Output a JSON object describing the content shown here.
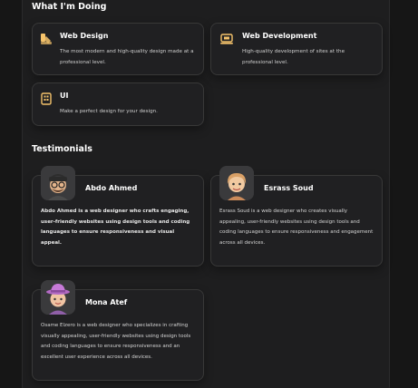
{
  "doing": {
    "title": "What I'm Doing",
    "services": [
      {
        "icon": "design-icon",
        "title": "Web Design",
        "text": "The most modern and high-quality design made at a professional level."
      },
      {
        "icon": "code-icon",
        "title": "Web Development",
        "text": "High-quality development of sites at the professional level."
      },
      {
        "icon": "ui-icon",
        "title": "UI",
        "text": "Make a perfect design for your design."
      }
    ]
  },
  "testimonials": {
    "title": "Testimonials",
    "items": [
      {
        "name": "Abdo Ahmed",
        "text": "Abdo Ahmed is a web designer who crafts engaging, user-friendly websites using design tools and coding languages to ensure responsiveness and visual appeal."
      },
      {
        "name": "Esrass Soud",
        "text": "Esrass Soud is a web designer who creates visually appealing, user-friendly websites using design tools and coding languages to ensure responsiveness and engagement across all devices."
      },
      {
        "name": "Mona Atef",
        "text": "Osame Elzero is a web designer who specializes in crafting visually appealing, user-friendly websites using design tools and coding languages to ensure responsiveness and an excellent user experience across all devices."
      }
    ]
  },
  "colors": {
    "accent": "#f5c36b",
    "card_bg": "#202022",
    "border": "#383838"
  }
}
